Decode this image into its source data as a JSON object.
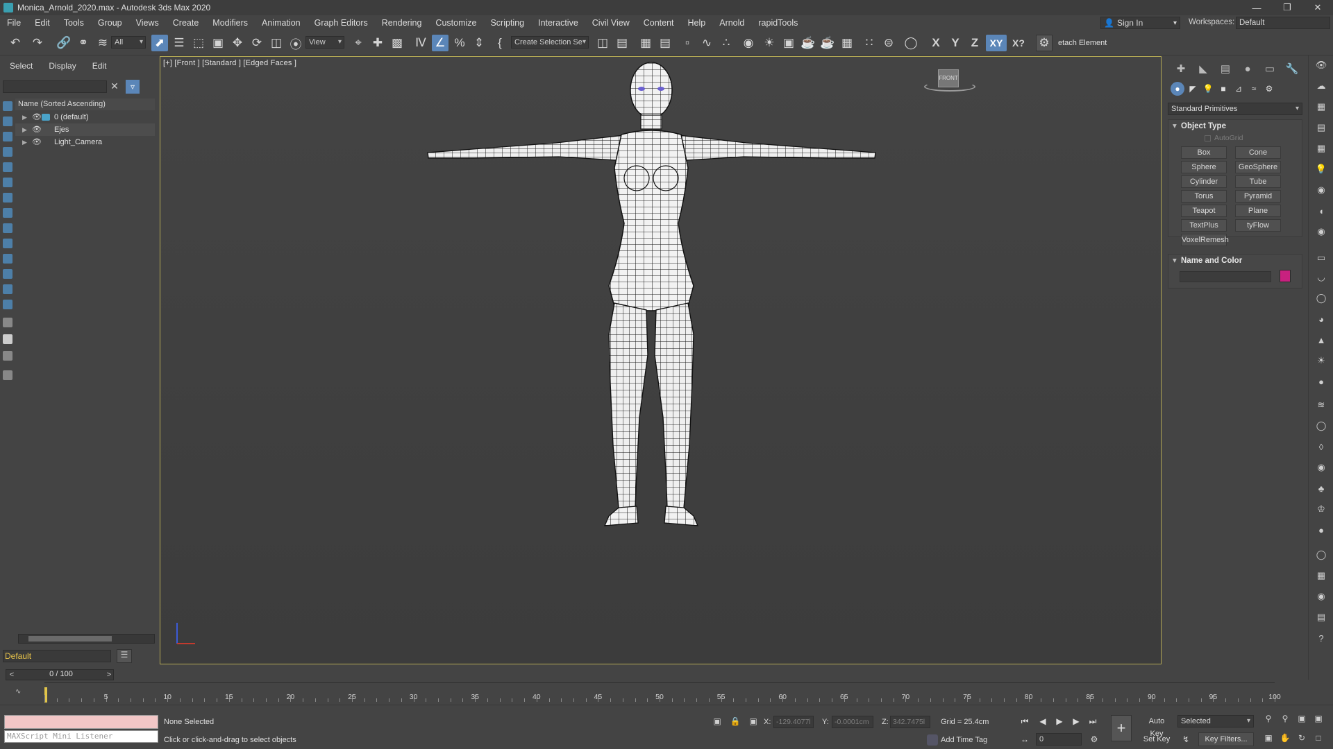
{
  "window": {
    "title": "Monica_Arnold_2020.max - Autodesk 3ds Max 2020",
    "minimize_icon": "minimize-icon",
    "restore_icon": "restore-icon",
    "close_icon": "close-icon"
  },
  "menubar": {
    "items": [
      "File",
      "Edit",
      "Tools",
      "Group",
      "Views",
      "Create",
      "Modifiers",
      "Animation",
      "Graph Editors",
      "Rendering",
      "Customize",
      "Scripting",
      "Interactive",
      "Civil View",
      "Content",
      "Help",
      "Arnold",
      "rapidTools"
    ],
    "sign_in": "Sign In",
    "workspaces_label": "Workspaces:",
    "workspace_value": "Default"
  },
  "toolbar": {
    "selection_filter": "All",
    "ref_coord": "View",
    "named_selection": "Create Selection Se",
    "axis_x": "X",
    "axis_y": "Y",
    "axis_z": "Z",
    "axis_xy": "XY",
    "axis_xq": "X?",
    "detach_label": "etach Element"
  },
  "explorer": {
    "tabs": [
      "Select",
      "Display",
      "Edit"
    ],
    "header": "Name (Sorted Ascending)",
    "rows": [
      "0 (default)",
      "Ejes",
      "Light_Camera"
    ]
  },
  "layer": {
    "current": "Default"
  },
  "viewport": {
    "label": "[+] [Front ] [Standard ] [Edged Faces ]",
    "viewcube_face": "FRONT"
  },
  "command_panel": {
    "category": "Standard Primitives",
    "object_type_title": "Object Type",
    "autogrid": "AutoGrid",
    "buttons": [
      "Box",
      "Cone",
      "Sphere",
      "GeoSphere",
      "Cylinder",
      "Tube",
      "Torus",
      "Pyramid",
      "Teapot",
      "Plane",
      "TextPlus",
      "tyFlow",
      "VoxelRemesh"
    ],
    "name_color_title": "Name and Color",
    "swatch_color": "#c8217f"
  },
  "timeline": {
    "frame_readout": "0 / 100",
    "ticks": [
      "5",
      "10",
      "15",
      "20",
      "25",
      "30",
      "35",
      "40",
      "45",
      "50",
      "55",
      "60",
      "65",
      "70",
      "75",
      "80",
      "85",
      "90",
      "95",
      "100"
    ]
  },
  "status": {
    "maxscript_placeholder": "MAXScript Mini Listener",
    "selection": "None Selected",
    "prompt": "Click or click-and-drag to select objects",
    "x_label": "X:",
    "x_value": "-129.4077l",
    "y_label": "Y:",
    "y_value": "-0.0001cm",
    "z_label": "Z:",
    "z_value": "342.7475l",
    "grid": "Grid = 25.4cm",
    "add_time_tag": "Add Time Tag",
    "frame": "0",
    "auto_key": "Auto Key",
    "set_key": "Set Key",
    "key_mode": "Selected",
    "key_filters": "Key Filters..."
  }
}
